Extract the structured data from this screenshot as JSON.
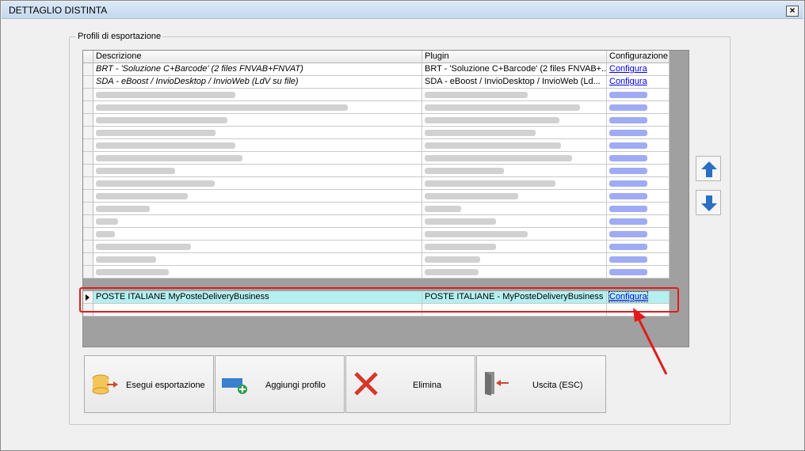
{
  "window": {
    "title": "DETTAGLIO DISTINTA",
    "close_glyph": "×"
  },
  "group": {
    "label": "Profili di esportazione"
  },
  "grid": {
    "headers": {
      "description": "Descrizione",
      "plugin": "Plugin",
      "config": "Configurazione"
    },
    "rows": [
      {
        "description": "BRT - 'Soluzione C+Barcode' (2 files FNVAB+FNVAT)",
        "plugin": "BRT - 'Soluzione C+Barcode' (2 files FNVAB+...",
        "config": "Configura",
        "italic": true
      },
      {
        "description": "SDA - eBoost / InvioDesktop / InvioWeb (LdV su file)",
        "plugin": "SDA - eBoost / InvioDesktop / InvioWeb (Ld...",
        "config": "Configura",
        "italic": true
      }
    ],
    "selected_row": {
      "description": "POSTE ITALIANE MyPosteDeliveryBusiness",
      "plugin": "POSTE ITALIANE - MyPosteDeliveryBusiness",
      "config": "Configura"
    },
    "blurred_row_count": 15
  },
  "side_buttons": [
    {
      "name": "move-up-button",
      "icon": "arrow-up-icon",
      "color": "#2a6fc4"
    },
    {
      "name": "move-down-button",
      "icon": "arrow-down-icon",
      "color": "#2a6fc4"
    }
  ],
  "buttons": {
    "export": "Esegui esportazione",
    "add_profile": "Aggiungi profilo",
    "delete": "Elimina",
    "exit": "Uscita (ESC)"
  },
  "colors": {
    "selection": "#b4f0f0",
    "highlight": "#e11b1b",
    "link": "#0000ee"
  }
}
